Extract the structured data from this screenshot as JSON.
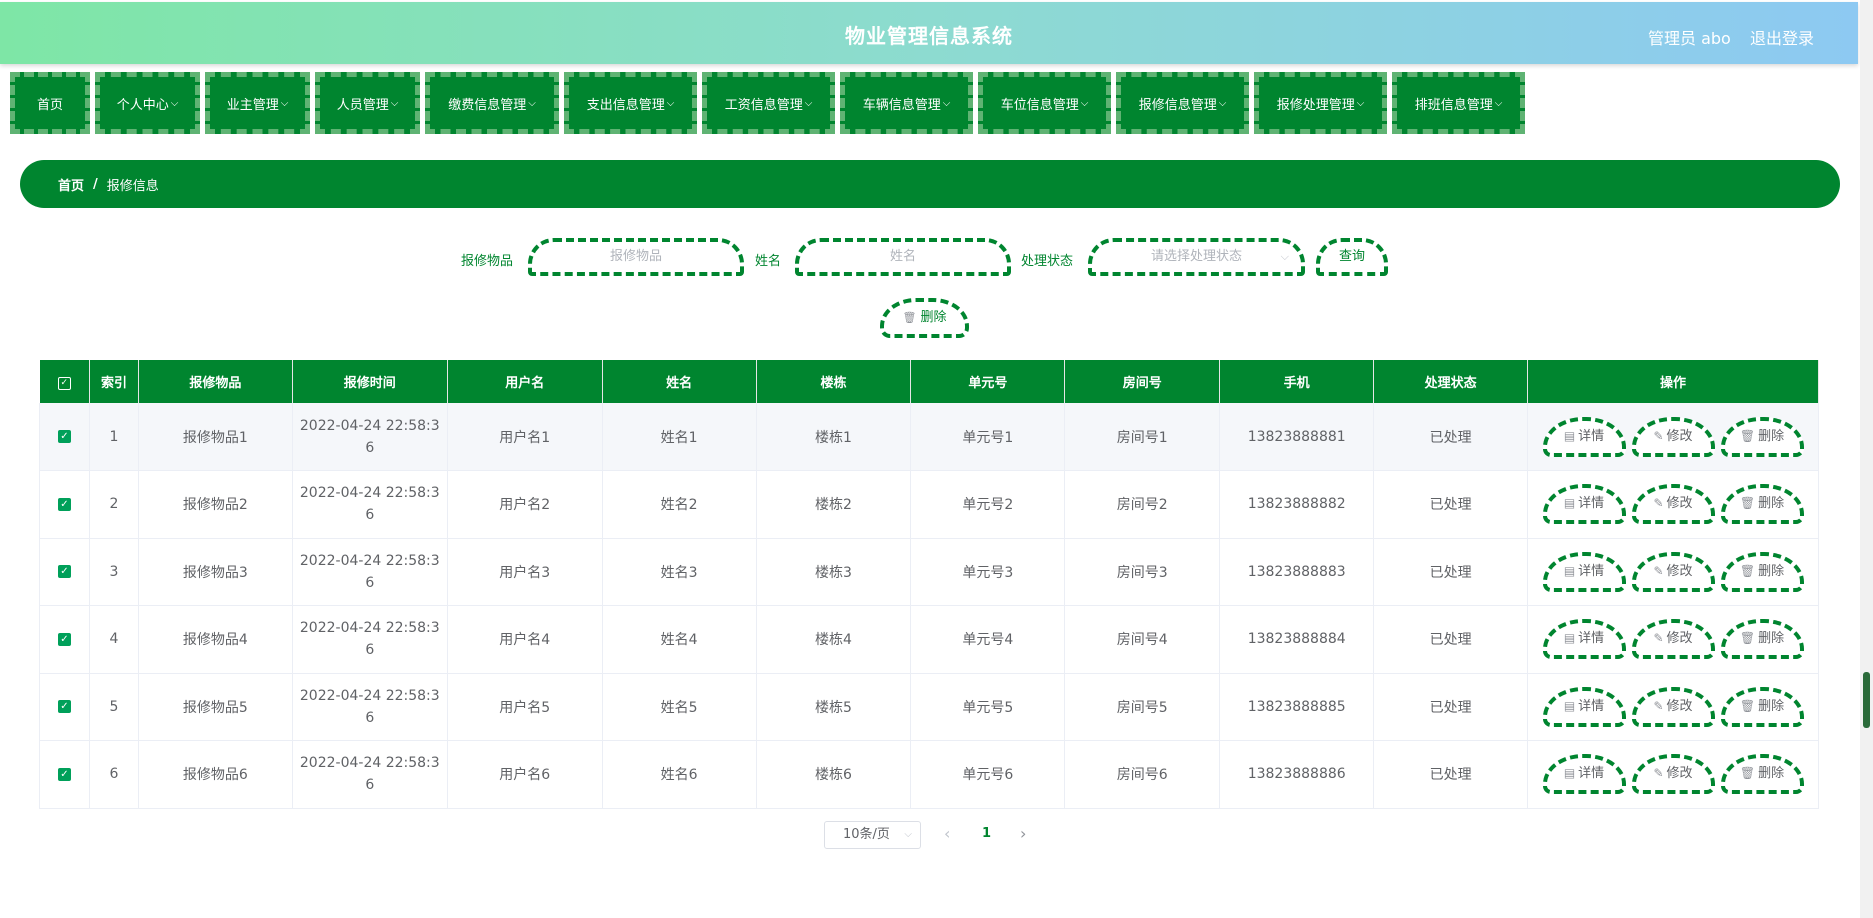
{
  "header": {
    "title": "物业管理信息系统",
    "user": "管理员 abo",
    "logout": "退出登录"
  },
  "menu": [
    {
      "label": "首页",
      "chev": ""
    },
    {
      "label": "个人中心",
      "chev": "⌵"
    },
    {
      "label": "业主管理",
      "chev": "⌵"
    },
    {
      "label": "人员管理",
      "chev": "⌵"
    },
    {
      "label": "缴费信息管理",
      "chev": "⌵"
    },
    {
      "label": "支出信息管理",
      "chev": "⌵"
    },
    {
      "label": "工资信息管理",
      "chev": "⌵"
    },
    {
      "label": "车辆信息管理",
      "chev": "⌵"
    },
    {
      "label": "车位信息管理",
      "chev": "⌵"
    },
    {
      "label": "报修信息管理",
      "chev": "⌵"
    },
    {
      "label": "报修处理管理",
      "chev": "⌵"
    },
    {
      "label": "排班信息管理",
      "chev": "⌵"
    }
  ],
  "breadcrumb": {
    "home": "首页",
    "sep": "/",
    "current": "报修信息"
  },
  "search": {
    "item_label": "报修物品",
    "item_placeholder": "报修物品",
    "name_label": "姓名",
    "name_placeholder": "姓名",
    "status_label": "处理状态",
    "status_placeholder": "请选择处理状态",
    "query_button": "查询",
    "delete_button": "删除"
  },
  "table": {
    "headers": [
      "索引",
      "报修物品",
      "报修时间",
      "用户名",
      "姓名",
      "楼栋",
      "单元号",
      "房间号",
      "手机",
      "处理状态",
      "操作"
    ],
    "rows": [
      {
        "index": "1",
        "item": "报修物品1",
        "time1": "2022-04-24 22:58:3",
        "time2": "6",
        "username": "用户名1",
        "name": "姓名1",
        "building": "楼栋1",
        "unit": "单元号1",
        "room": "房间号1",
        "phone": "13823888881",
        "status": "已处理"
      },
      {
        "index": "2",
        "item": "报修物品2",
        "time1": "2022-04-24 22:58:3",
        "time2": "6",
        "username": "用户名2",
        "name": "姓名2",
        "building": "楼栋2",
        "unit": "单元号2",
        "room": "房间号2",
        "phone": "13823888882",
        "status": "已处理"
      },
      {
        "index": "3",
        "item": "报修物品3",
        "time1": "2022-04-24 22:58:3",
        "time2": "6",
        "username": "用户名3",
        "name": "姓名3",
        "building": "楼栋3",
        "unit": "单元号3",
        "room": "房间号3",
        "phone": "13823888883",
        "status": "已处理"
      },
      {
        "index": "4",
        "item": "报修物品4",
        "time1": "2022-04-24 22:58:3",
        "time2": "6",
        "username": "用户名4",
        "name": "姓名4",
        "building": "楼栋4",
        "unit": "单元号4",
        "room": "房间号4",
        "phone": "13823888884",
        "status": "已处理"
      },
      {
        "index": "5",
        "item": "报修物品5",
        "time1": "2022-04-24 22:58:3",
        "time2": "6",
        "username": "用户名5",
        "name": "姓名5",
        "building": "楼栋5",
        "unit": "单元号5",
        "room": "房间号5",
        "phone": "13823888885",
        "status": "已处理"
      },
      {
        "index": "6",
        "item": "报修物品6",
        "time1": "2022-04-24 22:58:3",
        "time2": "6",
        "username": "用户名6",
        "name": "姓名6",
        "building": "楼栋6",
        "unit": "单元号6",
        "room": "房间号6",
        "phone": "13823888886",
        "status": "已处理"
      }
    ],
    "actions": {
      "detail": "详情",
      "edit": "修改",
      "delete": "删除"
    }
  },
  "pagination": {
    "page_size": "10条/页",
    "current_page": "1"
  },
  "colors": {
    "primary": "#00852f",
    "header_gradient_start": "#7ee6a6",
    "header_gradient_end": "#8dc9f2"
  }
}
